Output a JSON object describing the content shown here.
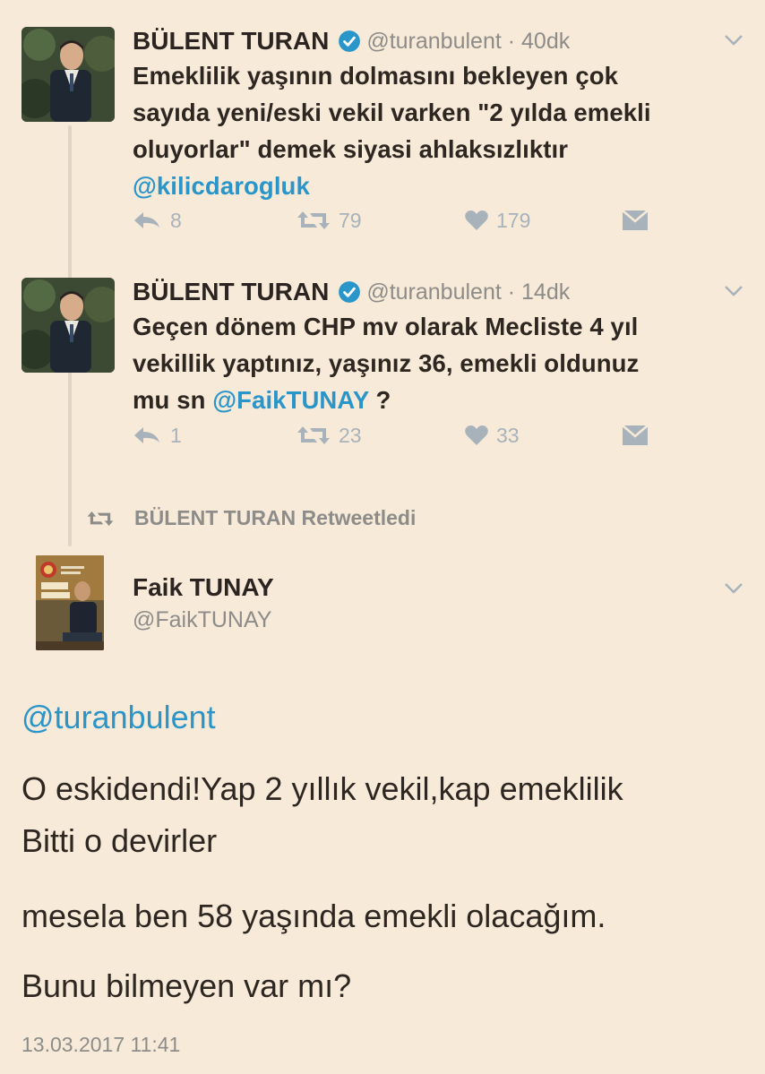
{
  "tweets": [
    {
      "name": "BÜLENT TURAN",
      "handle": "@turanbulent · 40dk",
      "text_lines": [
        "Emeklilik yaşının dolmasını bekleyen çok",
        "sayıda yeni/eski vekil varken \"2 yılda emekli",
        "oluyorlar\" demek siyasi ahlaksızlıktır"
      ],
      "mention": "@kilicdarogluk",
      "replies": "8",
      "retweets": "79",
      "likes": "179"
    },
    {
      "name": "BÜLENT TURAN",
      "handle": "@turanbulent · 14dk",
      "text_lines": [
        "Geçen dönem CHP mv olarak Mecliste 4 yıl",
        "vekillik yaptınız, yaşınız 36, emekli oldunuz"
      ],
      "line3_prefix": "mu sn ",
      "mention": "@FaikTUNAY",
      "line3_suffix": " ?",
      "replies": "1",
      "retweets": "23",
      "likes": "33"
    }
  ],
  "retweet_label": "BÜLENT TURAN Retweetledi",
  "retweeted": {
    "name": "Faik TUNAY",
    "handle": "@FaikTUNAY",
    "mention": "@turanbulent",
    "paragraphs": [
      "O eskidendi!Yap 2 yıllık vekil,kap emeklilik",
      "Bitti o devirler",
      "mesela ben 58 yaşında emekli olacağım.",
      "Bunu bilmeyen var mı?"
    ],
    "timestamp": "13.03.2017 11:41"
  },
  "colors": {
    "background": "#f7ead9",
    "link": "#2a95c9",
    "muted": "#8d8c89",
    "icon": "#a8b2ba"
  },
  "icons": [
    "reply-icon",
    "retweet-icon",
    "like-icon",
    "dm-icon",
    "verified-icon",
    "chevron-down-icon"
  ]
}
